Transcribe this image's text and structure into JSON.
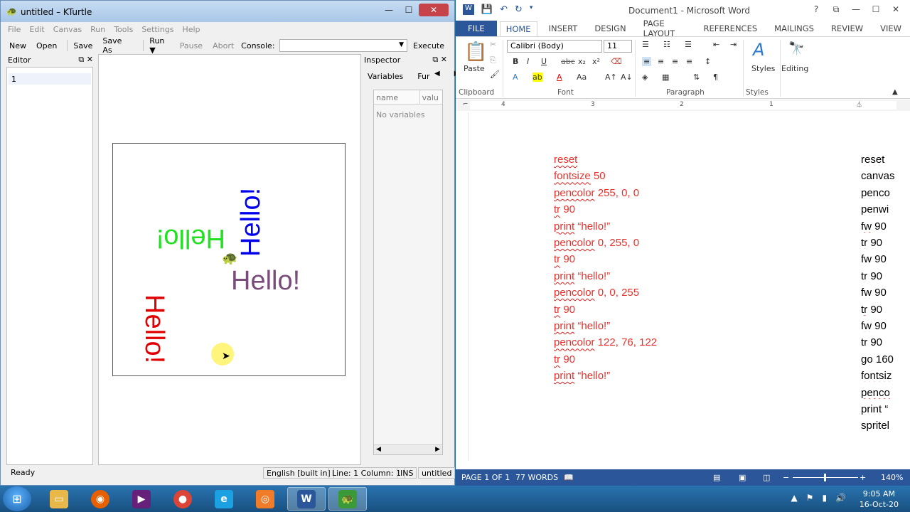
{
  "kturtle": {
    "title": "untitled – KTurtle",
    "menu": [
      "File",
      "Edit",
      "Canvas",
      "Run",
      "Tools",
      "Settings",
      "Help"
    ],
    "toolbar": {
      "new": "New",
      "open": "Open",
      "save": "Save",
      "save_as": "Save As",
      "run": "Run",
      "pause": "Pause",
      "abort": "Abort",
      "console_label": "Console:",
      "console_value": "",
      "execute": "Execute"
    },
    "editor": {
      "title": "Editor",
      "line_number": "1"
    },
    "canvas_texts": [
      {
        "text": "Hello!",
        "color": "#e00000"
      },
      {
        "text": "Hello!",
        "color": "#22e022"
      },
      {
        "text": "Hello!",
        "color": "#0000ee"
      },
      {
        "text": "Hello!",
        "color": "#7a4c7a"
      }
    ],
    "inspector": {
      "title": "Inspector",
      "tab_variables": "Variables",
      "tab_functions": "Fur",
      "col_name": "name",
      "col_value": "valu",
      "empty": "No variables"
    },
    "status": {
      "ready": "Ready",
      "language": "English [built in]",
      "position": "Line: 1 Column: 1",
      "mode": "INS",
      "file": "untitled"
    }
  },
  "word": {
    "title": "Document1 - Microsoft Word",
    "tabs": [
      "FILE",
      "HOME",
      "INSERT",
      "DESIGN",
      "PAGE LAYOUT",
      "REFERENCES",
      "MAILINGS",
      "REVIEW",
      "VIEW"
    ],
    "font_name": "Calibri (Body)",
    "font_size": "11",
    "groups": {
      "clipboard": "Clipboard",
      "font": "Font",
      "paragraph": "Paragraph",
      "styles": "Styles",
      "paste": "Paste",
      "styles_btn": "Styles",
      "editing": "Editing"
    },
    "ruler_numbers": [
      "4",
      "3",
      "2",
      "1"
    ],
    "code_left": [
      {
        "cmd": "reset",
        "args": ""
      },
      {
        "cmd": "fontsize",
        "args": " 50"
      },
      {
        "cmd": "pencolor",
        "args": " 255, 0, 0"
      },
      {
        "cmd": "tr",
        "args": " 90"
      },
      {
        "cmd": "print",
        "args": " “hello!”"
      },
      {
        "cmd": "pencolor",
        "args": " 0, 255, 0"
      },
      {
        "cmd": "tr",
        "args": " 90"
      },
      {
        "cmd": "print",
        "args": " “hello!”"
      },
      {
        "cmd": "pencolor",
        "args": " 0, 0, 255"
      },
      {
        "cmd": "tr",
        "args": " 90"
      },
      {
        "cmd": "print",
        "args": " “hello!”"
      },
      {
        "cmd": "pencolor",
        "args": " 122, 76, 122"
      },
      {
        "cmd": "tr",
        "args": " 90"
      },
      {
        "cmd": "print",
        "args": " “hello!”"
      }
    ],
    "code_right": [
      {
        "cmd": "reset",
        "args": ""
      },
      {
        "cmd": "canvas",
        "args": ""
      },
      {
        "cmd": "penco",
        "args": ""
      },
      {
        "cmd": "penwi",
        "args": ""
      },
      {
        "cmd": "fw",
        "args": " 90"
      },
      {
        "cmd": "tr",
        "args": " 90"
      },
      {
        "cmd": "fw",
        "args": " 90"
      },
      {
        "cmd": "tr",
        "args": " 90"
      },
      {
        "cmd": "fw",
        "args": " 90"
      },
      {
        "cmd": "tr",
        "args": " 90"
      },
      {
        "cmd": "fw",
        "args": " 90"
      },
      {
        "cmd": "tr",
        "args": " 90"
      },
      {
        "cmd": "go",
        "args": " 160"
      },
      {
        "cmd": "fontsiz",
        "args": ""
      },
      {
        "cmd": "penco",
        "args": ""
      },
      {
        "cmd": "print",
        "args": " “"
      },
      {
        "cmd": "spritel",
        "args": ""
      }
    ],
    "status": {
      "page": "PAGE 1 OF 1",
      "words": "77 WORDS",
      "zoom": "140%"
    }
  },
  "taskbar": {
    "time": "9:05 AM",
    "date": "16-Oct-20"
  }
}
